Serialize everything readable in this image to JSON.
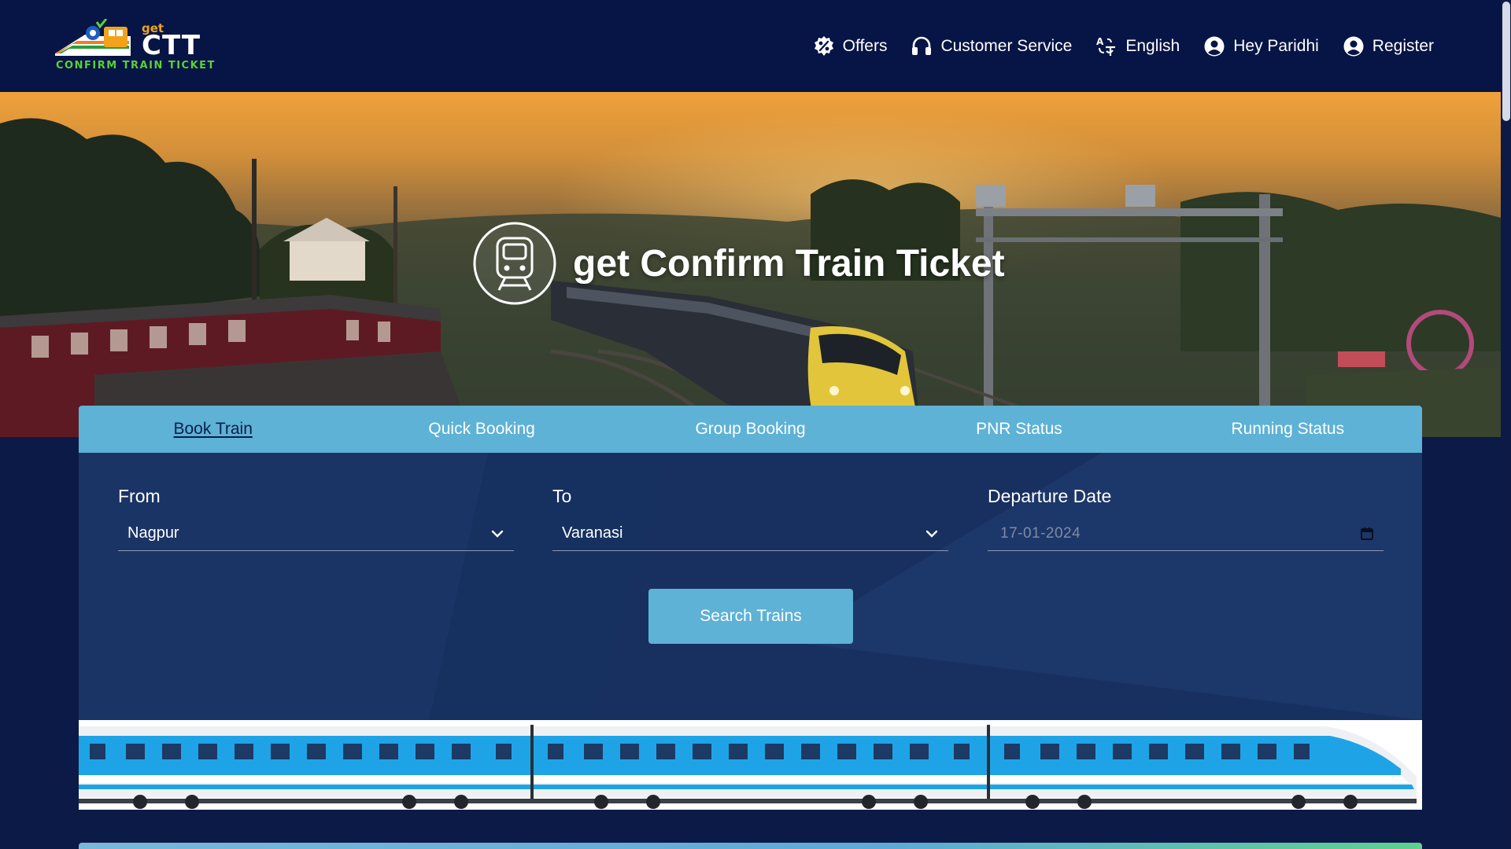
{
  "logo": {
    "top_text": "get",
    "main_text": "CTT",
    "tagline": "CONFIRM TRAIN TICKET"
  },
  "nav": {
    "items": [
      {
        "label": "Offers",
        "icon": "percent-badge-icon"
      },
      {
        "label": "Customer Service",
        "icon": "headset-icon"
      },
      {
        "label": "English",
        "icon": "language-icon"
      },
      {
        "label": "Hey Paridhi",
        "icon": "user-circle-icon"
      },
      {
        "label": "Register",
        "icon": "user-circle-icon"
      }
    ]
  },
  "hero": {
    "title": "get Confirm Train Ticket",
    "icon": "train-front-icon"
  },
  "booking": {
    "tabs": [
      {
        "label": "Book Train",
        "active": true
      },
      {
        "label": "Quick Booking",
        "active": false
      },
      {
        "label": "Group Booking",
        "active": false
      },
      {
        "label": "PNR Status",
        "active": false
      },
      {
        "label": "Running Status",
        "active": false
      }
    ],
    "from": {
      "label": "From",
      "value": "Nagpur"
    },
    "to": {
      "label": "To",
      "value": "Varanasi"
    },
    "date": {
      "label": "Departure Date",
      "value": "17-01-2024"
    },
    "search_label": "Search Trains"
  },
  "colors": {
    "header_bg": "#061545",
    "accent": "#5db2d6",
    "card_bg": "#163060",
    "page_bg": "#0b1a47"
  }
}
